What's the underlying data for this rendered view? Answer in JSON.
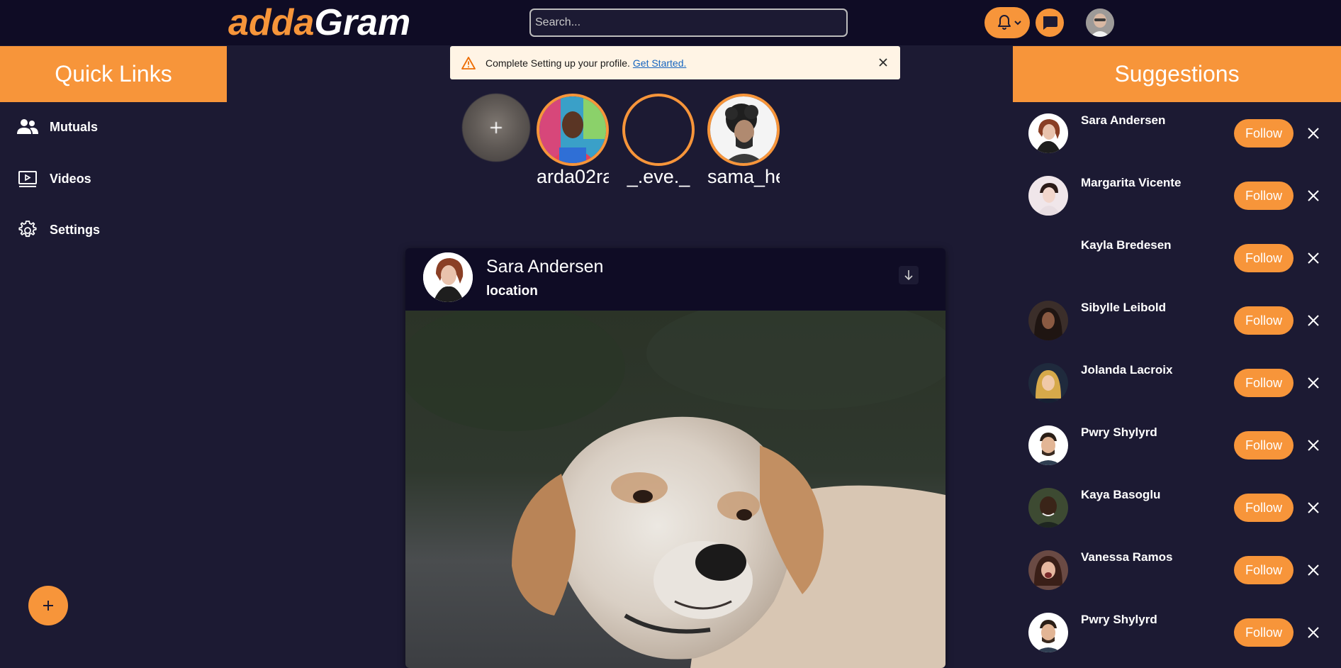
{
  "header": {
    "logo_part1": "adda",
    "logo_part2": "Gram",
    "search_placeholder": "Search...",
    "icons": [
      "bell-icon",
      "chevron-down-icon",
      "chat-icon"
    ]
  },
  "quick_links": {
    "title": "Quick Links",
    "items": [
      {
        "label": "Mutuals",
        "icon": "people-icon"
      },
      {
        "label": "Videos",
        "icon": "video-icon"
      },
      {
        "label": "Settings",
        "icon": "gear-icon"
      }
    ]
  },
  "alert": {
    "message": "Complete Setting up your profile.",
    "link": "Get Started."
  },
  "stories": [
    {
      "name": "arda02ra"
    },
    {
      "name": "_.eve._"
    },
    {
      "name": "sama_he"
    }
  ],
  "post": {
    "author": "Sara Andersen",
    "location": "location"
  },
  "suggestions": {
    "title": "Suggestions",
    "follow_label": "Follow",
    "people": [
      {
        "name": "Sara Andersen"
      },
      {
        "name": "Margarita Vicente"
      },
      {
        "name": "Kayla Bredesen"
      },
      {
        "name": "Sibylle Leibold"
      },
      {
        "name": "Jolanda Lacroix"
      },
      {
        "name": "Pwry Shylyrd"
      },
      {
        "name": "Kaya Basoglu"
      },
      {
        "name": "Vanessa Ramos"
      },
      {
        "name": "Pwry Shylyrd"
      }
    ]
  },
  "colors": {
    "accent": "#f7953a",
    "background": "#1c1a33",
    "header_bg": "#0f0c25"
  }
}
